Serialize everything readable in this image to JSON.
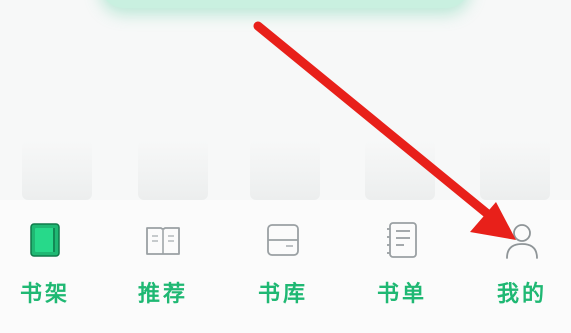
{
  "accent_color": "#1fb873",
  "annotation_color": "#e8201a",
  "tabbar": {
    "active_tab": "书架",
    "tabs": [
      {
        "label": "书架",
        "icon": "bookshelf-icon"
      },
      {
        "label": "推荐",
        "icon": "open-book-icon"
      },
      {
        "label": "书库",
        "icon": "book-library-icon"
      },
      {
        "label": "书单",
        "icon": "book-list-icon"
      },
      {
        "label": "我的",
        "icon": "profile-person-icon"
      }
    ]
  }
}
